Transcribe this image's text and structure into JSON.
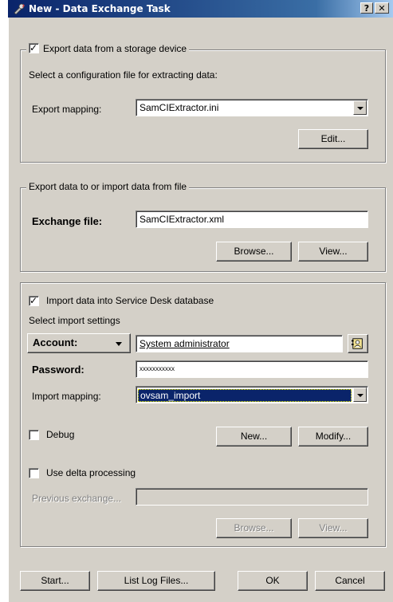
{
  "window": {
    "title": "New - Data Exchange Task",
    "help_button": "?",
    "close_button": "✕"
  },
  "export_group": {
    "checkbox_label": "Export data from a storage device",
    "checked": true,
    "instruction": "Select a configuration file for extracting data:",
    "mapping_label": "Export mapping:",
    "mapping_value": "SamCIExtractor.ini",
    "edit_button": "Edit..."
  },
  "file_group": {
    "legend": "Export data to or import data from file",
    "exchange_label": "Exchange file:",
    "exchange_value": "SamCIExtractor.xml",
    "browse_button": "Browse...",
    "view_button": "View..."
  },
  "import_group": {
    "checkbox_label": "Import data into Service Desk database",
    "checked": true,
    "settings_label": "Select import settings",
    "account_button": "Account:",
    "account_value": "System administrator",
    "password_label": "Password:",
    "password_value": "xxxxxxxxxxx",
    "mapping_label": "Import mapping:",
    "mapping_value": "ovsam_import",
    "debug_label": "Debug",
    "debug_checked": false,
    "new_button": "New...",
    "modify_button": "Modify...",
    "delta_label": "Use delta processing",
    "delta_checked": false,
    "previous_label": "Previous exchange...",
    "previous_value": "",
    "browse_button": "Browse...",
    "view_button": "View..."
  },
  "footer": {
    "start_button": "Start...",
    "log_button": "List Log Files...",
    "ok_button": "OK",
    "cancel_button": "Cancel"
  },
  "icons": {
    "app_icon": "tools-icon",
    "lookup_icon": "contact-card-icon"
  }
}
